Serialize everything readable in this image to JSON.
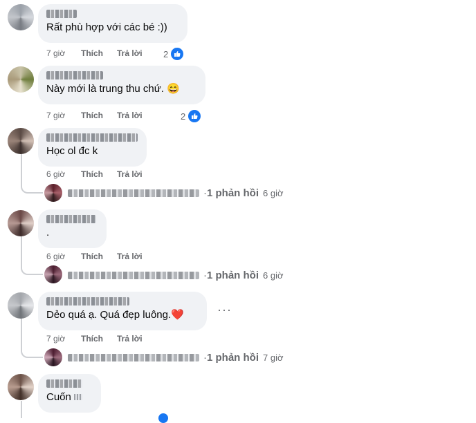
{
  "comments": [
    {
      "text": "Rất phù hợp với các bé :))",
      "time": "7 giờ",
      "like": "Thích",
      "reply": "Trả lời",
      "reactions": "2",
      "emoji": ""
    },
    {
      "text": "Này mới là trung thu chứ.",
      "time": "7 giờ",
      "like": "Thích",
      "reply": "Trả lời",
      "reactions": "2",
      "emoji": "😄"
    },
    {
      "text": "Học ol đc k",
      "time": "6 giờ",
      "like": "Thích",
      "reply": "Trả lời",
      "reply_count": "1 phản hồi",
      "reply_time": "6 giờ"
    },
    {
      "text": ".",
      "time": "6 giờ",
      "like": "Thích",
      "reply": "Trả lời",
      "reply_count": "1 phản hồi",
      "reply_time": "6 giờ"
    },
    {
      "text": "Dẻo quá ạ. Quá đẹp luông.",
      "time": "7 giờ",
      "like": "Thích",
      "reply": "Trả lời",
      "emoji": "❤️",
      "reply_count": "1 phản hồi",
      "reply_time": "7 giờ",
      "more": "···"
    },
    {
      "text": "Cuốn"
    }
  ],
  "colors": {
    "bubble": "#f0f2f5",
    "meta": "#65676b",
    "like_blue": "#1877f2"
  },
  "icons": {
    "like": "thumbs-up-icon",
    "more": "more-horizontal-icon"
  }
}
